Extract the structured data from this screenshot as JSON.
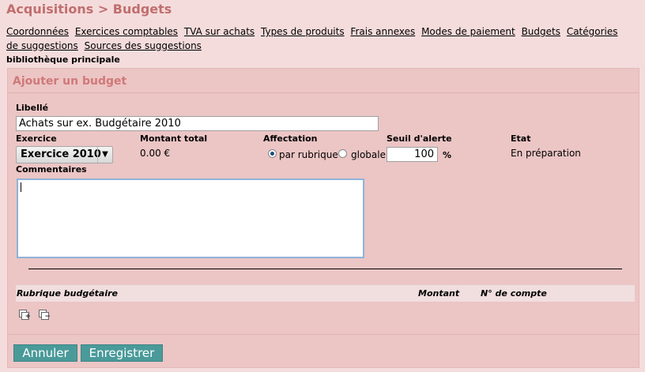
{
  "page": {
    "title": "Acquisitions > Budgets"
  },
  "nav": [
    "Coordonnées",
    "Exercices comptables",
    "TVA sur achats",
    "Types de produits",
    "Frais annexes",
    "Modes de paiement",
    "Budgets",
    "Catégories de suggestions",
    "Sources des suggestions"
  ],
  "section": "bibliothèque principale",
  "form": {
    "heading": "Ajouter un budget",
    "libelle_label": "Libellé",
    "libelle_value": "Achats sur ex. Budgétaire 2010",
    "exercice_label": "Exercice",
    "exercice_value": "Exercice 2010",
    "montant_label": "Montant total",
    "montant_value": "0.00 €",
    "affectation_label": "Affectation",
    "affectation_options": [
      "par rubrique",
      "globale"
    ],
    "affectation_selected": "par rubrique",
    "seuil_label": "Seuil d'alerte",
    "seuil_value": "100",
    "seuil_unit": "%",
    "etat_label": "Etat",
    "etat_value": "En préparation",
    "commentaires_label": "Commentaires",
    "commentaires_value": ""
  },
  "table": {
    "columns": [
      "Rubrique budgétaire",
      "Montant",
      "N° de compte"
    ],
    "rows": []
  },
  "actions": {
    "cancel": "Annuler",
    "save": "Enregistrer"
  },
  "icons": {
    "add": "add-rubrique-icon",
    "remove": "remove-rubrique-icon"
  }
}
